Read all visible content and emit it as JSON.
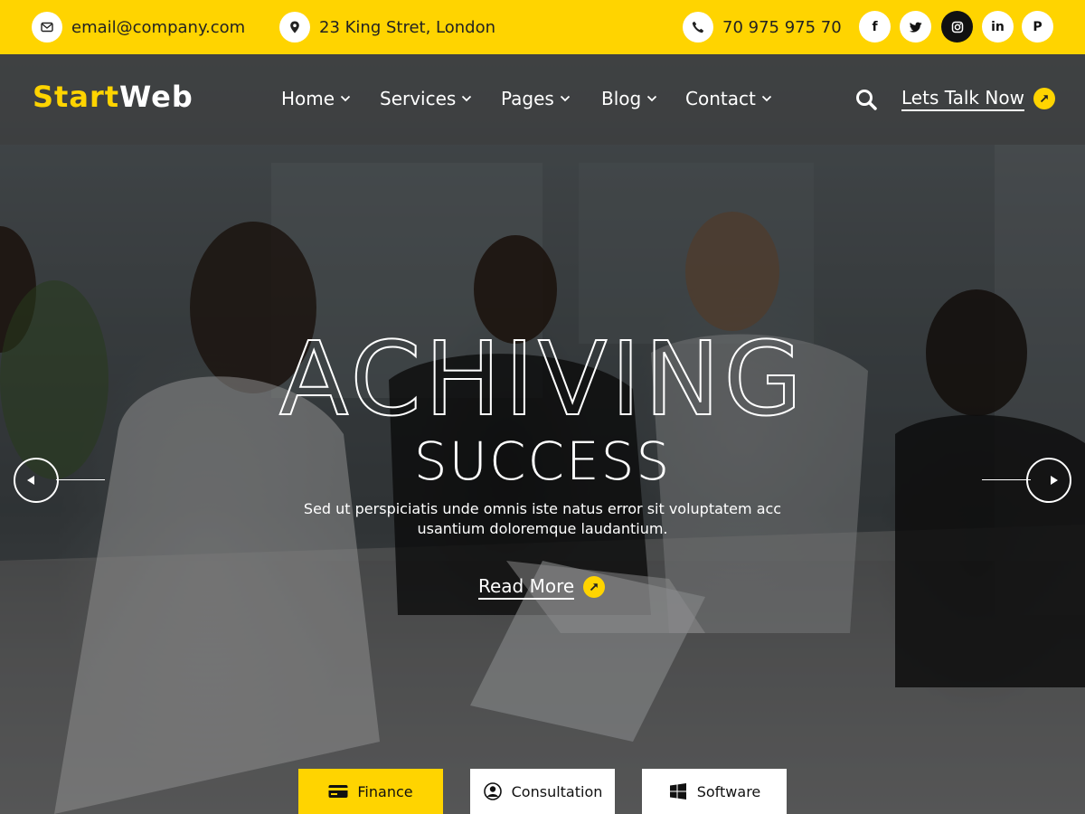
{
  "topbar": {
    "email": "email@company.com",
    "address": "23 King Stret, London",
    "phone": "70 975 975 70",
    "social": [
      {
        "icon": "facebook-icon",
        "glyph": "f"
      },
      {
        "icon": "twitter-icon",
        "glyph": ""
      },
      {
        "icon": "instagram-icon",
        "glyph": ""
      },
      {
        "icon": "linkedin-icon",
        "glyph": "in"
      },
      {
        "icon": "pinterest-icon",
        "glyph": "P"
      }
    ]
  },
  "logo": {
    "part1": "Start",
    "part2": "Web"
  },
  "nav": {
    "items": [
      {
        "label": "Home"
      },
      {
        "label": "Services"
      },
      {
        "label": "Pages"
      },
      {
        "label": "Blog"
      },
      {
        "label": "Contact"
      }
    ],
    "cta": "Lets Talk Now"
  },
  "hero": {
    "headline_outline": "ACHIVING",
    "headline_solid": "SUCCESS",
    "description": "Sed ut perspiciatis unde omnis iste natus error sit voluptatem acc usantium doloremque laudantium.",
    "read_more": "Read More"
  },
  "tabs": [
    {
      "label": "Finance",
      "icon": "credit-card-icon",
      "active": true
    },
    {
      "label": "Consultation",
      "icon": "user-circle-icon",
      "active": false
    },
    {
      "label": "Software",
      "icon": "windows-icon",
      "active": false
    }
  ],
  "colors": {
    "accent": "#ffd400",
    "text_dark": "#222222",
    "white": "#ffffff"
  }
}
